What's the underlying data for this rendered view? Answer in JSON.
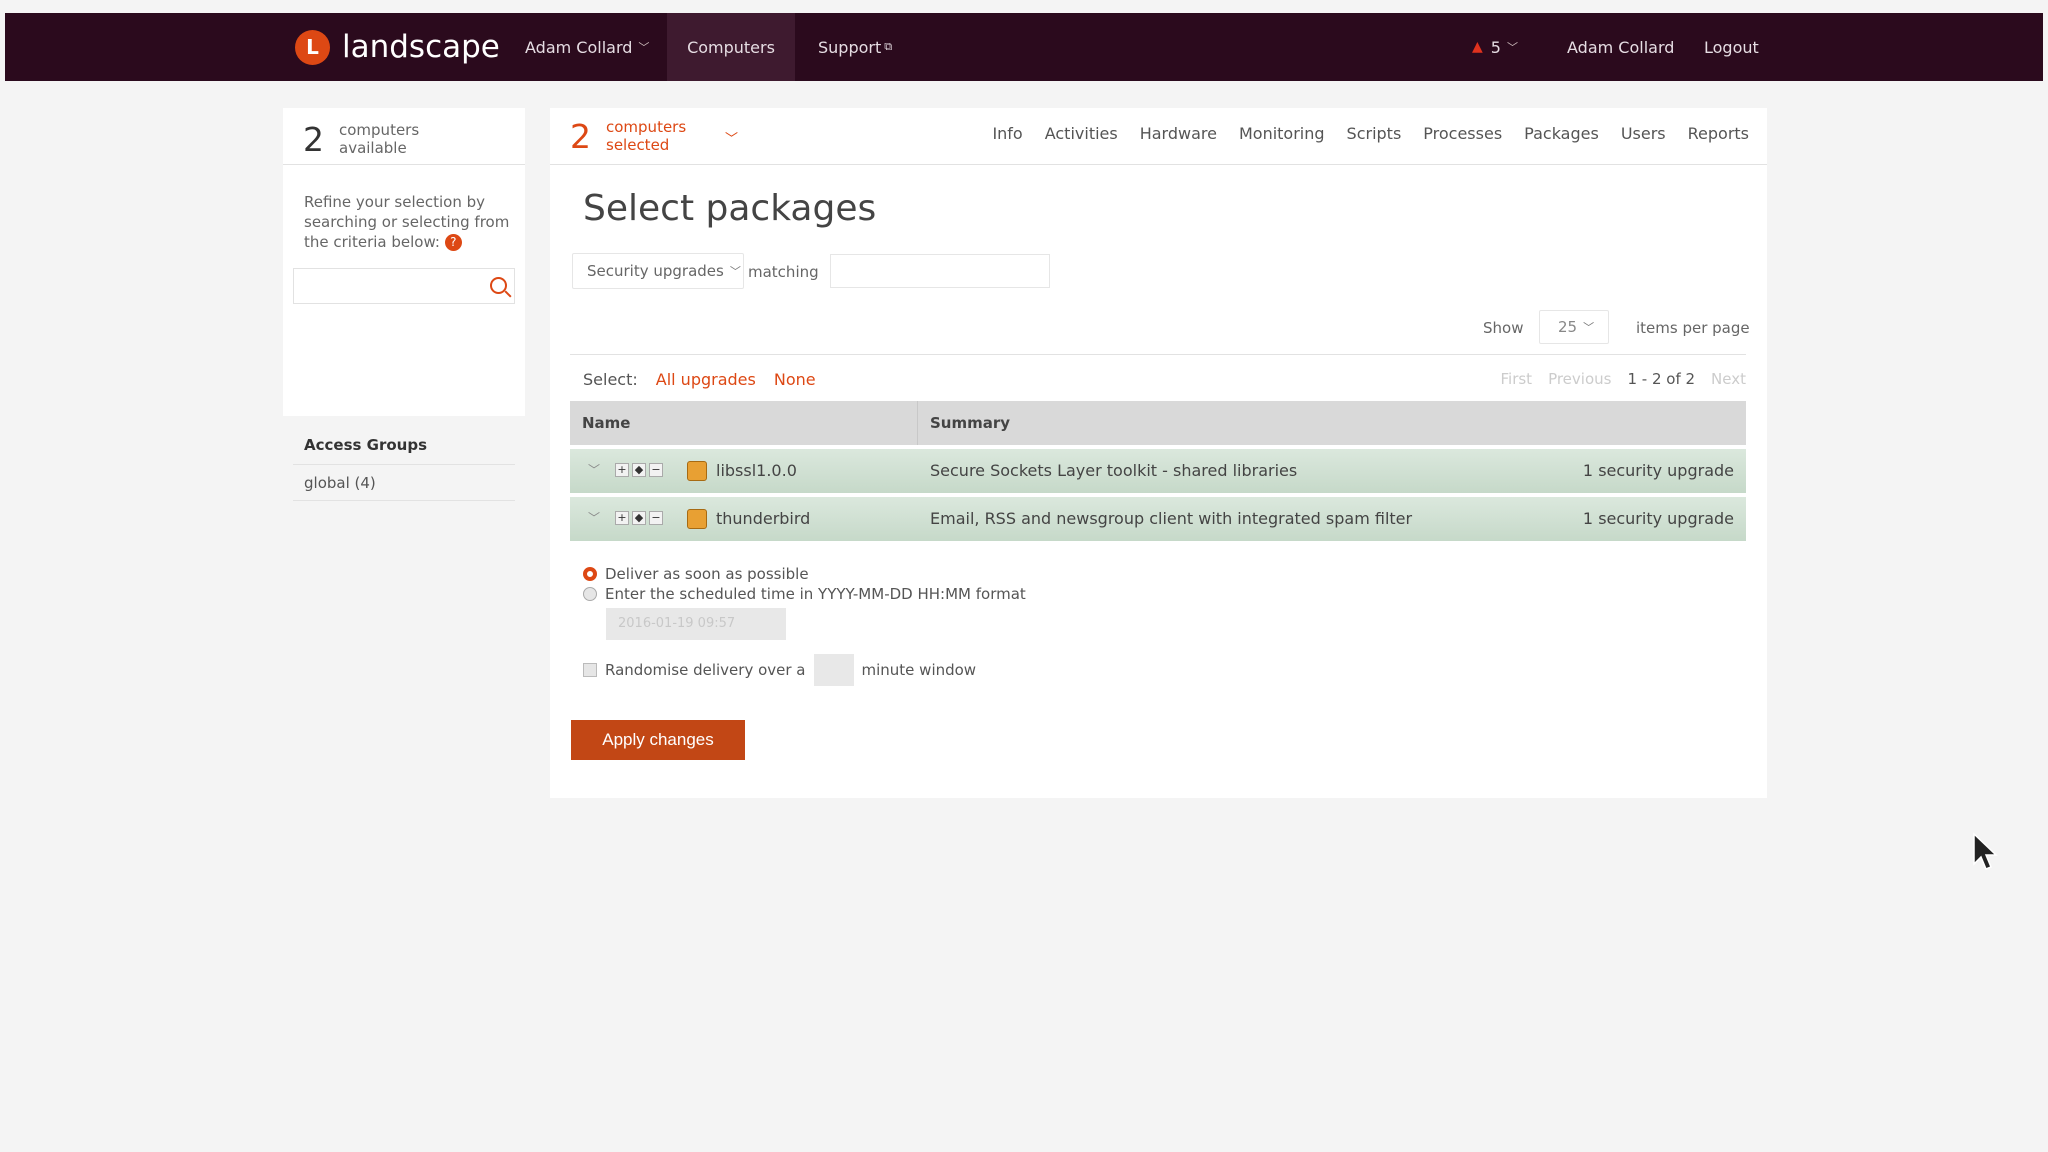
{
  "topbar": {
    "logo_text": "landscape",
    "account_menu": "Adam Collard",
    "nav_computers": "Computers",
    "nav_support": "Support",
    "alert_count": "5",
    "user_name": "Adam Collard",
    "logout": "Logout",
    "colors": {
      "bar": "#2b0a1d",
      "accent": "#dd4814"
    }
  },
  "left_panel": {
    "count": "2",
    "count_line1": "computers",
    "count_line2": "available",
    "refine_text": "Refine your selection by searching or selecting from the criteria below:",
    "help_glyph": "?",
    "search_value": "",
    "access_groups_title": "Access Groups",
    "access_group_item": "global (4)"
  },
  "main": {
    "selected_count": "2",
    "selected_line1": "computers",
    "selected_line2": "selected",
    "subnav": [
      "Info",
      "Activities",
      "Hardware",
      "Monitoring",
      "Scripts",
      "Processes",
      "Packages",
      "Users",
      "Reports"
    ],
    "title": "Select packages",
    "filter_value": "Security upgrades",
    "matching_label": "matching",
    "matching_value": "",
    "show_label": "Show",
    "per_page": "25",
    "items_per_page_label": "items per page",
    "select_label": "Select:",
    "select_all": "All upgrades",
    "select_none": "None",
    "pager": {
      "first": "First",
      "previous": "Previous",
      "range": "1 - 2 of 2",
      "next": "Next"
    },
    "table": {
      "headers": [
        "Name",
        "Summary"
      ],
      "rows": [
        {
          "name": "libssl1.0.0",
          "summary": "Secure Sockets Layer toolkit - shared libraries",
          "upgrade": "1 security upgrade"
        },
        {
          "name": "thunderbird",
          "summary": "Email, RSS and newsgroup client with integrated spam filter",
          "upgrade": "1 security upgrade"
        }
      ]
    },
    "delivery": {
      "option_asap": "Deliver as soon as possible",
      "option_scheduled": "Enter the scheduled time in YYYY-MM-DD HH:MM format",
      "scheduled_value": "2016-01-19 09:57",
      "randomise_before": "Randomise delivery over a",
      "randomise_after": "minute window",
      "randomise_value": ""
    },
    "apply_button": "Apply changes"
  },
  "icons": {
    "logo": "landscape-logo-icon",
    "search": "search-icon",
    "help": "help-icon",
    "alert": "warning-triangle-icon",
    "package": "package-icon",
    "cursor": "mouse-pointer-icon"
  }
}
